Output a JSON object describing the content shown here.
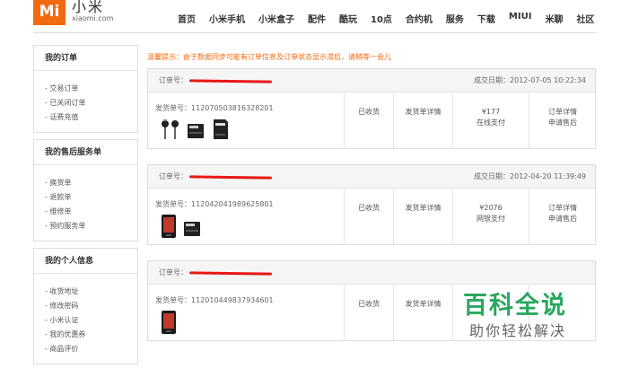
{
  "header": {
    "logo_text": "Mi",
    "brand_cn": "小米",
    "brand_en": "xiaomi.com",
    "nav": [
      "首页",
      "小米手机",
      "小米盒子",
      "配件",
      "酷玩",
      "10点",
      "合约机",
      "服务",
      "下载",
      "MIUI",
      "米聊",
      "社区"
    ]
  },
  "sidebar": [
    {
      "title": "我的订单",
      "items": [
        "- 交易订单",
        "- 已关闭订单",
        "- 话费充值"
      ]
    },
    {
      "title": "我的售后服务单",
      "items": [
        "- 换货单",
        "- 退款单",
        "- 维修单",
        "- 预约服务单"
      ]
    },
    {
      "title": "我的个人信息",
      "items": [
        "- 收货地址",
        "- 修改密码",
        "- 小米认证",
        "- 我的优惠券",
        "- 商品评价"
      ]
    }
  ],
  "notice": "温馨提示：由于数据同步可能有订单信息及订单状态显示滞后，请稍等一会儿",
  "orders": [
    {
      "order_label": "订单号：",
      "date": "成交日期：2012-07-05 10:22:34",
      "shipping": "发货单号：1120705038163282​01",
      "status": "已收货",
      "detail": "发货单详情",
      "amount": "¥177",
      "payment": "在线支付",
      "op1": "订单详情",
      "op2": "申请售后"
    },
    {
      "order_label": "订单号：",
      "date": "成交日期：2012-04-20 11:39:49",
      "shipping": "发货单号：1120420419896258​01",
      "status": "已收货",
      "detail": "发货单详情",
      "amount": "¥2076",
      "payment": "网银支付",
      "op1": "订单详情",
      "op2": "申请售后"
    },
    {
      "order_label": "订单号：",
      "date": "",
      "shipping": "发货单号：1120104498379346​01",
      "status": "已收货",
      "detail": "发货单详情",
      "amount": "",
      "payment": "",
      "op1": "",
      "op2": ""
    }
  ],
  "watermark": {
    "line1": "百科全说",
    "line2": "助你轻松解决"
  }
}
